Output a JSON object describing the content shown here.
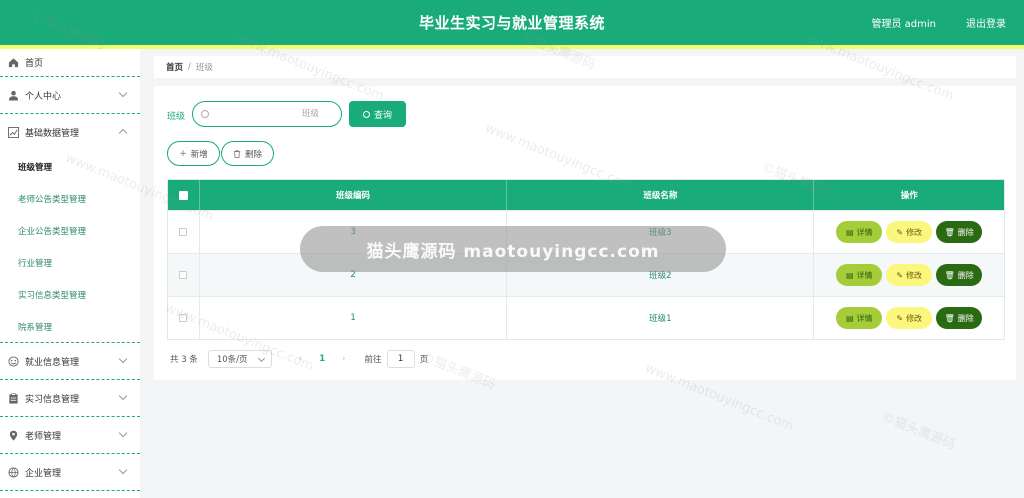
{
  "header": {
    "title": "毕业生实习与就业管理系统",
    "user": "管理员 admin",
    "logout": "退出登录"
  },
  "sidebar": {
    "items": [
      {
        "label": "首页",
        "icon": "home-icon"
      },
      {
        "label": "个人中心",
        "icon": "user-icon"
      },
      {
        "label": "基础数据管理",
        "icon": "chart-icon",
        "expanded": true
      },
      {
        "label": "就业信息管理",
        "icon": "smile-icon"
      },
      {
        "label": "实习信息管理",
        "icon": "clipboard-icon"
      },
      {
        "label": "老师管理",
        "icon": "location-icon"
      },
      {
        "label": "企业管理",
        "icon": "globe-icon"
      }
    ],
    "sub_items": [
      "班级管理",
      "老师公告类型管理",
      "企业公告类型管理",
      "行业管理",
      "实习信息类型管理",
      "院系管理"
    ]
  },
  "breadcrumb": {
    "home": "首页",
    "sep": "/",
    "current": "班级"
  },
  "search": {
    "label": "班级",
    "placeholder": "班级",
    "query_label": "查询"
  },
  "actions": {
    "add_label": "新增",
    "delete_label": "删除"
  },
  "table": {
    "columns": [
      "班级编码",
      "班级名称",
      "操作"
    ],
    "rows": [
      {
        "code": "3",
        "name": "班级3"
      },
      {
        "code": "2",
        "name": "班级2"
      },
      {
        "code": "1",
        "name": "班级1"
      }
    ],
    "op_detail": "详情",
    "op_edit": "修改",
    "op_delete": "删除"
  },
  "pager": {
    "total": "共 3 条",
    "page_size": "10条/页",
    "current": "1",
    "goto": "前往",
    "goto_value": "1",
    "unit": "页"
  },
  "watermark": {
    "center": "猫头鹰源码 maotouyingcc.com",
    "tile_cn": "©猫头鹰源码",
    "tile_en": "www.maotouyingcc.com"
  },
  "colors": {
    "primary": "#1aab7a",
    "strip": "#f3ff6a",
    "detail": "#a5cd3a",
    "edit": "#faf77c",
    "delete": "#2a6a13"
  }
}
